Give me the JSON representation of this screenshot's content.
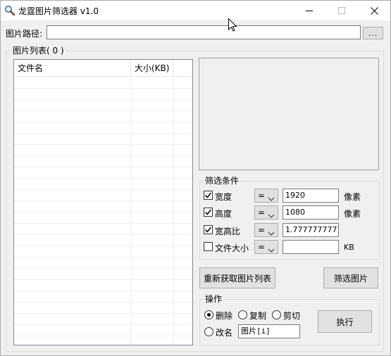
{
  "window": {
    "title": "龙霆图片筛选器 v1.0"
  },
  "path": {
    "label": "图片路径:",
    "value": "",
    "browse_label": "..."
  },
  "image_list": {
    "group_title": "图片列表( 0 )",
    "columns": [
      "文件名",
      "大小(KB)"
    ],
    "rows": []
  },
  "filter": {
    "group_title": "筛选条件",
    "rows": [
      {
        "label": "宽度",
        "checked": true,
        "operator": "=",
        "value": "1920",
        "unit": "像素"
      },
      {
        "label": "高度",
        "checked": true,
        "operator": "=",
        "value": "1080",
        "unit": "像素"
      },
      {
        "label": "宽高比",
        "checked": true,
        "operator": "=",
        "value": "1.7777777777",
        "unit": ""
      },
      {
        "label": "文件大小",
        "checked": false,
        "operator": "=",
        "value": "",
        "unit": "KB"
      }
    ]
  },
  "buttons": {
    "refresh_label": "重新获取图片列表",
    "filter_label": "筛选图片",
    "execute_label": "执行"
  },
  "operation": {
    "group_title": "操作",
    "options": [
      {
        "label": "删除",
        "selected": true
      },
      {
        "label": "复制",
        "selected": false
      },
      {
        "label": "剪切",
        "selected": false
      },
      {
        "label": "改名",
        "selected": false
      }
    ],
    "rename_pattern": "图片[i]"
  },
  "icons": {
    "app": "magnifier-icon",
    "minimize": "minimize-icon",
    "maximize": "maximize-icon",
    "close": "close-icon",
    "dropdown": "chevron-down-icon",
    "check": "check-icon",
    "cursor": "mouse-cursor-icon"
  }
}
